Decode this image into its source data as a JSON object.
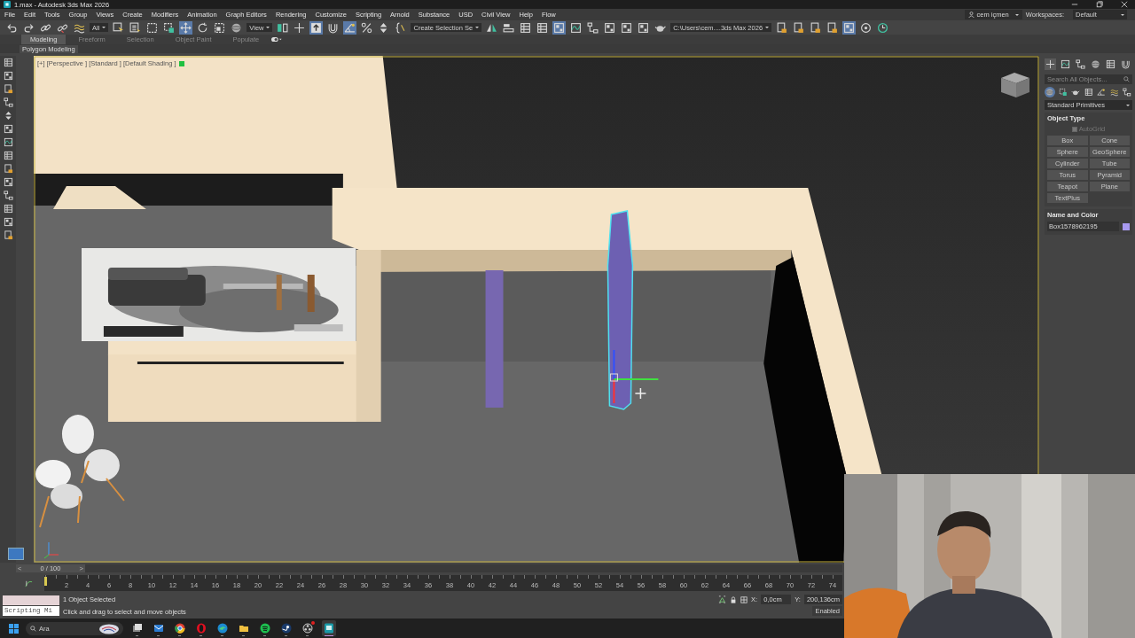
{
  "window": {
    "title": "1.max - Autodesk 3ds Max 2026"
  },
  "menu": [
    "File",
    "Edit",
    "Tools",
    "Group",
    "Views",
    "Create",
    "Modifiers",
    "Animation",
    "Graph Editors",
    "Rendering",
    "Customize",
    "Scripting",
    "Arnold",
    "Substance",
    "USD",
    "Civil View",
    "Help",
    "Flow"
  ],
  "user": {
    "name": "cem içmen"
  },
  "workspaces": {
    "label": "Workspaces:",
    "value": "Default"
  },
  "toolbar": [
    {
      "kind": "button",
      "selected": false
    },
    {
      "kind": "button",
      "selected": false
    },
    {
      "kind": "button",
      "selected": false
    },
    {
      "kind": "button",
      "selected": false
    },
    {
      "kind": "button",
      "selected": false
    },
    {
      "kind": "dropdown",
      "value": "All"
    },
    {
      "kind": "button",
      "selected": false
    },
    {
      "kind": "button",
      "selected": false
    },
    {
      "kind": "button",
      "selected": false
    },
    {
      "kind": "button",
      "selected": false
    },
    {
      "kind": "button",
      "selected": true
    },
    {
      "kind": "button",
      "selected": false
    },
    {
      "kind": "button",
      "selected": false
    },
    {
      "kind": "button",
      "selected": false
    },
    {
      "kind": "dropdown",
      "value": "View"
    },
    {
      "kind": "button",
      "selected": false
    },
    {
      "kind": "button",
      "selected": false
    },
    {
      "kind": "button",
      "selected": true
    },
    {
      "kind": "button",
      "selected": false
    },
    {
      "kind": "button",
      "selected": true
    },
    {
      "kind": "button",
      "selected": false
    },
    {
      "kind": "button",
      "selected": false
    },
    {
      "kind": "button",
      "selected": false
    },
    {
      "kind": "dropdown",
      "value": "Create Selection Se"
    },
    {
      "kind": "button",
      "selected": false
    },
    {
      "kind": "button",
      "selected": false
    },
    {
      "kind": "button",
      "selected": false
    },
    {
      "kind": "button",
      "selected": false
    },
    {
      "kind": "button",
      "selected": true
    },
    {
      "kind": "button",
      "selected": false
    },
    {
      "kind": "button",
      "selected": false
    },
    {
      "kind": "button",
      "selected": false
    },
    {
      "kind": "button",
      "selected": false
    },
    {
      "kind": "button",
      "selected": false
    },
    {
      "kind": "button",
      "selected": false
    },
    {
      "kind": "dropdown",
      "value": "C:\\Users\\cem....3ds Max 2026"
    },
    {
      "kind": "button",
      "selected": false
    },
    {
      "kind": "button",
      "selected": false
    },
    {
      "kind": "button",
      "selected": false
    },
    {
      "kind": "button",
      "selected": false
    },
    {
      "kind": "button",
      "selected": true
    },
    {
      "kind": "button",
      "selected": false
    },
    {
      "kind": "button",
      "selected": false
    }
  ],
  "ribbon_tabs": [
    {
      "label": "Modeling",
      "selected": true
    },
    {
      "label": "Freeform",
      "selected": false
    },
    {
      "label": "Selection",
      "selected": false
    },
    {
      "label": "Object Paint",
      "selected": false
    },
    {
      "label": "Populate",
      "selected": false
    }
  ],
  "ribbon_panel": "Polygon Modeling",
  "viewport": {
    "label": "[+] [Perspective ] [Standard ] [Default Shading ]"
  },
  "command_panel": {
    "tabs": [
      {
        "selected": true
      },
      {
        "selected": false
      },
      {
        "selected": false
      },
      {
        "selected": false
      },
      {
        "selected": false
      },
      {
        "selected": false
      }
    ],
    "search": {
      "placeholder": "Search All Objects..."
    },
    "categories": [
      {
        "selected": true
      },
      {
        "selected": false
      },
      {
        "selected": false
      },
      {
        "selected": false
      },
      {
        "selected": false
      },
      {
        "selected": false
      },
      {
        "selected": false
      }
    ],
    "category": "Standard Primitives",
    "object_type": {
      "title": "Object Type",
      "autogrid": {
        "label": "AutoGrid",
        "checked": true
      },
      "buttons": [
        "Box",
        "Cone",
        "Sphere",
        "GeoSphere",
        "Cylinder",
        "Tube",
        "Torus",
        "Pyramid",
        "Teapot",
        "Plane",
        "TextPlus"
      ]
    },
    "name_color": {
      "title": "Name and Color",
      "name": "Box1578962195",
      "color": "#a89af0"
    }
  },
  "time_slider": {
    "prev": "<",
    "label": "0 / 100",
    "next": ">",
    "level": 0
  },
  "ruler": [
    "2",
    "4",
    "6",
    "8",
    "10",
    "12",
    "14",
    "16",
    "18",
    "20",
    "22",
    "24",
    "26",
    "28",
    "30",
    "32",
    "34",
    "36",
    "38",
    "40",
    "42",
    "44",
    "46",
    "48",
    "50",
    "52",
    "54",
    "56",
    "58",
    "60",
    "62",
    "64",
    "66",
    "68",
    "70",
    "72",
    "74"
  ],
  "status": {
    "listener": "Scripting Mi",
    "selected": "1 Object Selected",
    "prompt": "Click and drag to select and move objects",
    "x": {
      "label": "X:",
      "value": "0,0cm"
    },
    "y": {
      "label": "Y:",
      "value": "200,136cm"
    },
    "enabled": "Enabled"
  },
  "taskbar": {
    "search": {
      "placeholder": "Ara"
    },
    "apps": [
      {
        "selected": false,
        "badge": false
      },
      {
        "selected": false,
        "badge": false
      },
      {
        "selected": false,
        "badge": false
      },
      {
        "selected": false,
        "badge": false
      },
      {
        "selected": false,
        "badge": false
      },
      {
        "selected": false,
        "badge": false
      },
      {
        "selected": false,
        "badge": false
      },
      {
        "selected": false,
        "badge": false
      },
      {
        "selected": false,
        "badge": true
      },
      {
        "selected": true,
        "badge": false
      }
    ]
  }
}
